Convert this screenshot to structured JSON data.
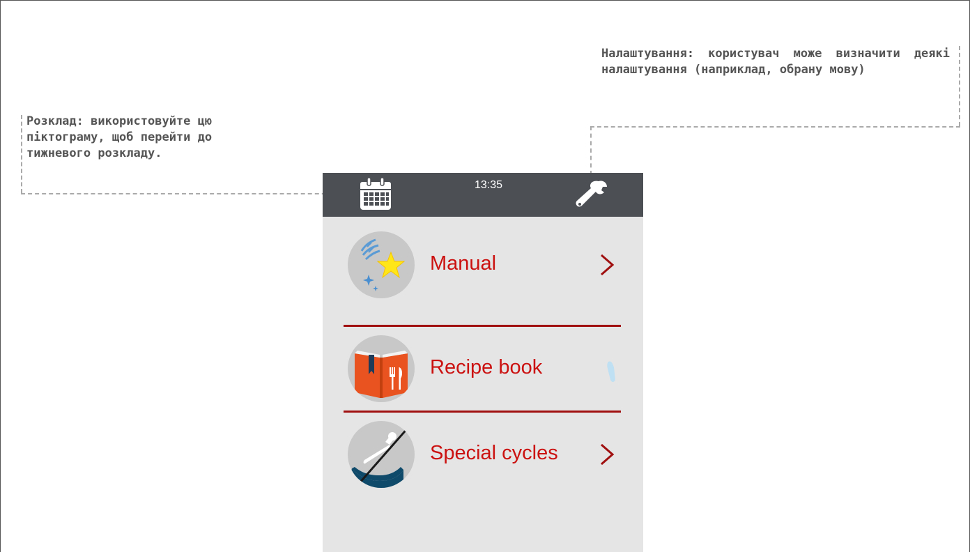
{
  "annotations": {
    "schedule": "Розклад: використовуйте цю піктограму, щоб перейти до тижневого розкладу.",
    "settings": "Налаштування: користувач може визначити деякі налаштування (наприклад, обрану мову)"
  },
  "device": {
    "topbar": {
      "time": "13:35",
      "left_icon": "calendar-icon",
      "right_icon": "wrench-icon"
    },
    "menu": [
      {
        "label": "Manual",
        "icon": "manual-sparkle-icon",
        "chevron": true
      },
      {
        "label": "Recipe book",
        "icon": "recipe-book-icon",
        "chevron": false
      },
      {
        "label": "Special cycles",
        "icon": "special-cycles-icon",
        "chevron": true
      }
    ],
    "colors": {
      "topbar": "#4c4f54",
      "screen_bg": "#e5e5e5",
      "accent": "#cc1111",
      "divider": "#a01010"
    }
  }
}
